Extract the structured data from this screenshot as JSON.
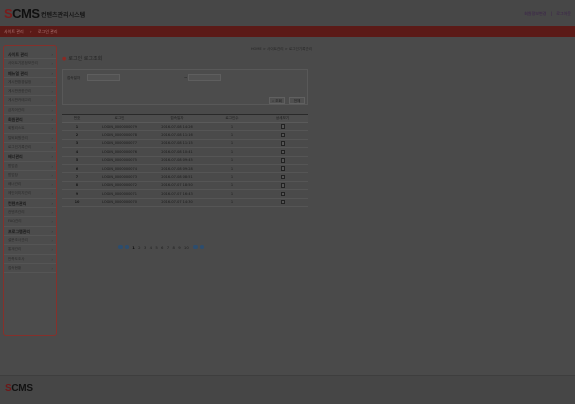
{
  "header": {
    "logo_s": "S",
    "logo_rest": "CMS",
    "logo_subtitle": "컨텐츠관리시스템",
    "links": [
      "회원정보변경",
      "로그아웃"
    ]
  },
  "navbar": {
    "crumbs": [
      "사이트 관리",
      "로그인 관리"
    ]
  },
  "sidebar": {
    "items": [
      {
        "label": "사이트 관리",
        "head": true
      },
      {
        "label": "사이트기본정보관리",
        "head": false
      },
      {
        "label": "메뉴얼 관리",
        "head": true
      },
      {
        "label": "게시판환경설정",
        "head": false
      },
      {
        "label": "게시판권한관리",
        "head": false
      },
      {
        "label": "게시판카테고리",
        "head": false
      },
      {
        "label": "금지어관리",
        "head": false
      },
      {
        "label": "회원관리",
        "head": true
      },
      {
        "label": "회원리스트",
        "head": false
      },
      {
        "label": "탈퇴회원관리",
        "head": false
      },
      {
        "label": "로그인기록관리",
        "head": false
      },
      {
        "label": "배너관리",
        "head": true
      },
      {
        "label": "팝업존",
        "head": false
      },
      {
        "label": "팝업창",
        "head": false
      },
      {
        "label": "배너관리",
        "head": false
      },
      {
        "label": "메인이미지관리",
        "head": false
      },
      {
        "label": "컨텐츠관리",
        "head": true
      },
      {
        "label": "컨텐츠관리",
        "head": false
      },
      {
        "label": "FAQ관리",
        "head": false
      },
      {
        "label": "프로그램관리",
        "head": true
      },
      {
        "label": "설문조사관리",
        "head": false
      },
      {
        "label": "통계관리",
        "head": false
      },
      {
        "label": "만족도조사",
        "head": false
      },
      {
        "label": "접속현황",
        "head": false
      }
    ]
  },
  "main": {
    "path": "HOME > 사이트관리 > 로그인기록관리",
    "title": "로그인 로그조회",
    "search": {
      "label": "접속일자",
      "date_from": "",
      "date_to": "",
      "tilde": "~",
      "btn_search": "조회",
      "btn_all": "전체"
    },
    "table": {
      "headers": [
        "번호",
        "로그인",
        "접속일자",
        "로그인수",
        "상세보기"
      ],
      "rows": [
        {
          "no": "1",
          "id": "LOGIN_0000000079",
          "date": "2016-07-08 14:26",
          "count": "1"
        },
        {
          "no": "2",
          "id": "LOGIN_0000000078",
          "date": "2016-07-08 11:16",
          "count": "1"
        },
        {
          "no": "3",
          "id": "LOGIN_0000000077",
          "date": "2016-07-08 11:15",
          "count": "1"
        },
        {
          "no": "4",
          "id": "LOGIN_0000000076",
          "date": "2016-07-08 10:41",
          "count": "1"
        },
        {
          "no": "5",
          "id": "LOGIN_0000000075",
          "date": "2016-07-08 09:45",
          "count": "1"
        },
        {
          "no": "6",
          "id": "LOGIN_0000000074",
          "date": "2016-07-08 09:28",
          "count": "1"
        },
        {
          "no": "7",
          "id": "LOGIN_0000000073",
          "date": "2016-07-08 08:51",
          "count": "1"
        },
        {
          "no": "8",
          "id": "LOGIN_0000000072",
          "date": "2016-07-07 18:50",
          "count": "1"
        },
        {
          "no": "9",
          "id": "LOGIN_0000000071",
          "date": "2016-07-07 16:43",
          "count": "1"
        },
        {
          "no": "10",
          "id": "LOGIN_0000000070",
          "date": "2016-07-07 14:30",
          "count": "1"
        }
      ]
    },
    "pager": {
      "pages": [
        "1",
        "2",
        "3",
        "4",
        "5",
        "6",
        "7",
        "8",
        "9",
        "10"
      ]
    }
  },
  "footer": {
    "logo_s": "S",
    "logo_rest": "CMS"
  },
  "colors": {
    "brand_red": "#5b1a17",
    "sidebar_border": "#86302b",
    "pager_circle": "#2c4d6e"
  }
}
